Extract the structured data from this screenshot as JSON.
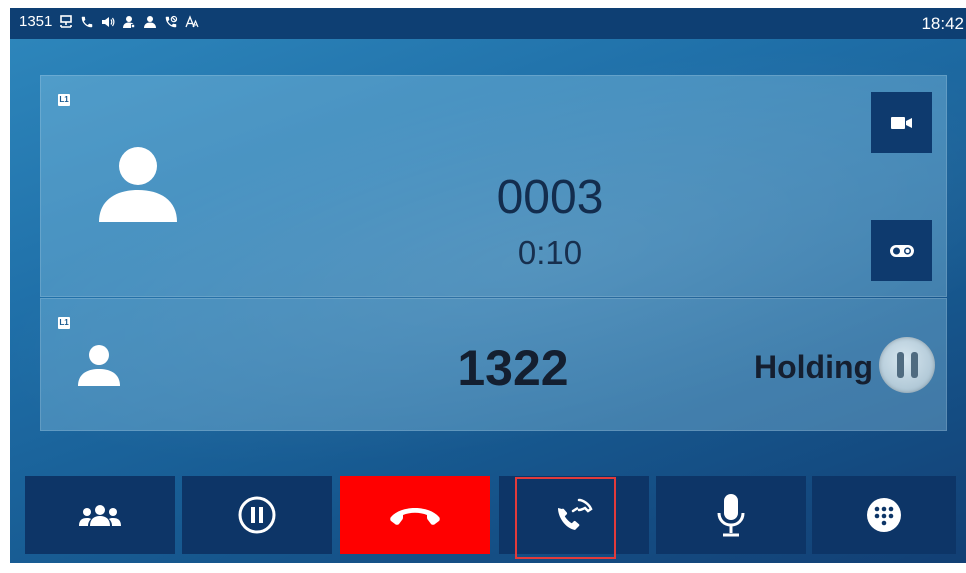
{
  "status_bar": {
    "extension": "1351",
    "time": "18:42",
    "icons": [
      "network-icon",
      "phone-icon",
      "speaker-icon",
      "contact-icon",
      "user-icon",
      "dnd-icon",
      "auto-answer-icon"
    ]
  },
  "active_call": {
    "line": "L1",
    "number": "0003",
    "duration": "0:10",
    "buttons": [
      "video-icon",
      "record-icon"
    ]
  },
  "held_call": {
    "line": "L1",
    "number": "1322",
    "status": "Holding"
  },
  "softkeys": [
    {
      "name": "conference",
      "icon": "conference-icon"
    },
    {
      "name": "hold",
      "icon": "hold-icon"
    },
    {
      "name": "end-call",
      "icon": "end-call-icon",
      "color": "#ff0000"
    },
    {
      "name": "transfer",
      "icon": "transfer-icon",
      "highlighted": true
    },
    {
      "name": "mute",
      "icon": "microphone-icon"
    },
    {
      "name": "keypad",
      "icon": "keypad-icon"
    }
  ],
  "colors": {
    "status_bar": "#0e3f73",
    "softkey_bg": "#0d3567",
    "end_call": "#ff0000",
    "highlight_border": "#e23b3b"
  }
}
